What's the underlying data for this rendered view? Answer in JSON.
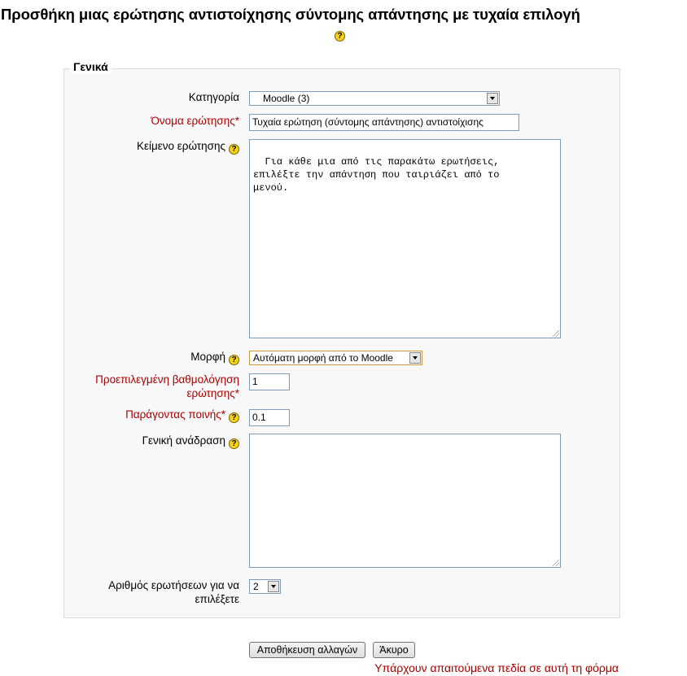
{
  "page": {
    "title": "Προσθήκη μιας ερώτησης αντιστοίχησης σύντομης απάντησης με τυχαία επιλογή",
    "title_help_icon": "help-icon"
  },
  "fieldset": {
    "legend": "Γενικά"
  },
  "fields": {
    "category": {
      "label": "Κατηγορία",
      "value": "Moodle (3)"
    },
    "question_name": {
      "label": "Όνομα ερώτησης",
      "required_mark": "*",
      "value": "Τυχαία ερώτηση (σύντομης απάντησης) αντιστοίχισης"
    },
    "question_text": {
      "label": "Κείμενο ερώτησης",
      "value": "Για κάθε μια από τις παρακάτω ερωτήσεις,\nεπιλέξτε την απάντηση που ταιριάζει από το\nμενού."
    },
    "format": {
      "label": "Μορφή",
      "value": "Αυτόματη μορφή από το Moodle"
    },
    "default_grade": {
      "label_line1": "Προεπιλεγμένη βαθμολόγηση",
      "label_line2": "ερώτησης",
      "required_mark": "*",
      "value": "1"
    },
    "penalty": {
      "label": "Παράγοντας ποινής",
      "required_mark": "*",
      "value": "0.1"
    },
    "general_feedback": {
      "label": "Γενική ανάδραση",
      "value": ""
    },
    "choose_count": {
      "label_line1": "Αριθμός ερωτήσεων για να",
      "label_line2": "επιλέξετε",
      "value": "2"
    }
  },
  "buttons": {
    "save": "Αποθήκευση αλλαγών",
    "cancel": "Άκυρο"
  },
  "footer": {
    "required_note": "Υπάρχουν απαιτούμενα πεδία σε αυτή τη φόρμα"
  },
  "colors": {
    "required": "#aa0000",
    "help_icon": "#f7d21c",
    "fieldset_bg": "#f8f8f8"
  }
}
